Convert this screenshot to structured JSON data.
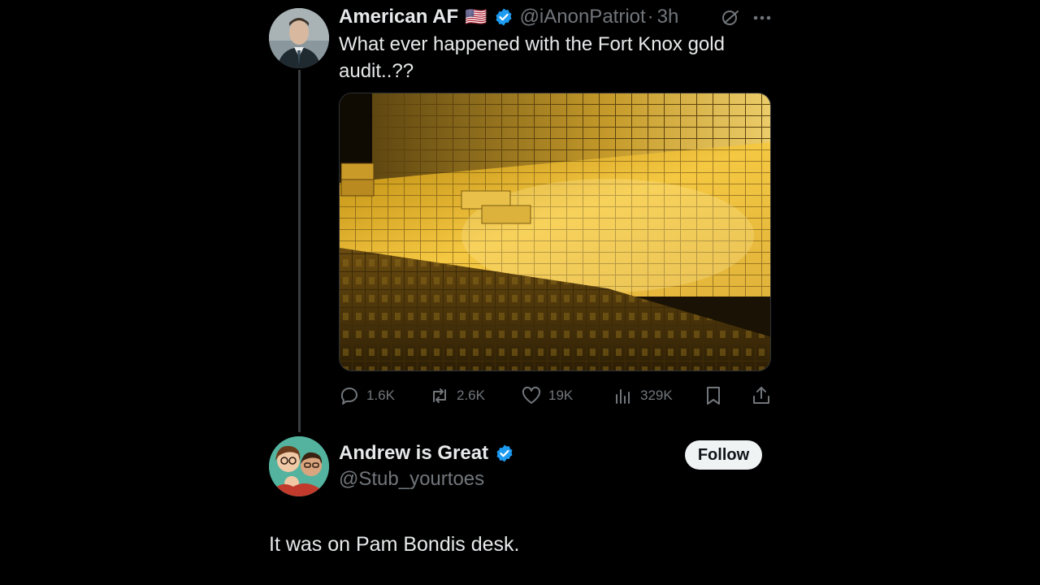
{
  "original_tweet": {
    "author_name": "American AF",
    "flag_emoji": "🇺🇸",
    "handle": "@iAnonPatriot",
    "separator": "·",
    "time": "3h",
    "text_line1": "What ever happened with the Fort Knox gold",
    "text_line2": "audit..??",
    "media_alt": "Stacked gold bars in a vault",
    "actions": {
      "replies": "1.6K",
      "reposts": "2.6K",
      "likes": "19K",
      "views": "329K"
    }
  },
  "reply": {
    "author_name": "Andrew is Great",
    "handle": "@Stub_yourtoes",
    "follow_label": "Follow",
    "text": "It was on Pam Bondis desk."
  },
  "icons": {
    "verified": "verified-badge-icon",
    "grok": "grok-icon",
    "more": "more-icon",
    "reply": "reply-icon",
    "repost": "repost-icon",
    "like": "like-icon",
    "views": "views-icon",
    "bookmark": "bookmark-icon",
    "share": "share-icon"
  },
  "colors": {
    "background": "#000000",
    "text": "#e7e9ea",
    "muted": "#71767b",
    "verified": "#1d9bf0",
    "follow_bg": "#eff3f4"
  }
}
